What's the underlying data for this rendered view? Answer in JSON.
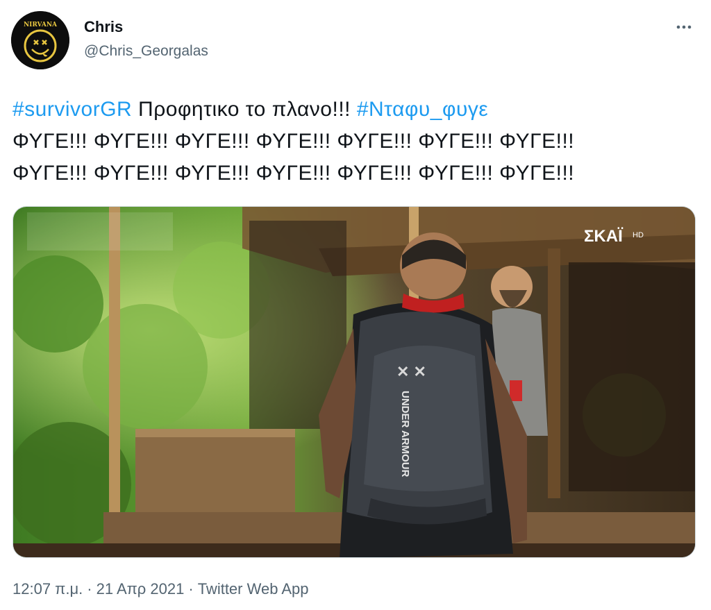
{
  "author": {
    "name": "Chris",
    "handle": "@Chris_Georgalas",
    "avatar_text": "NIRVANA",
    "avatar_icon": "smiley-face-icon"
  },
  "more_icon": "more-horizontal-icon",
  "tweet": {
    "hashtag1": "#survivorGR",
    "text1": " Προφητικο το πλανο!!! ",
    "hashtag2": "#Νταφυ_φυγε",
    "line2": "ΦΥΓΕ!!! ΦΥΓΕ!!! ΦΥΓΕ!!! ΦΥΓΕ!!! ΦΥΓΕ!!! ΦΥΓΕ!!! ΦΥΓΕ!!!",
    "line3": "ΦΥΓΕ!!! ΦΥΓΕ!!! ΦΥΓΕ!!! ΦΥΓΕ!!! ΦΥΓΕ!!! ΦΥΓΕ!!! ΦΥΓΕ!!!"
  },
  "media": {
    "channel_logo": "ΣΚΑΪ",
    "channel_logo_suffix": "HD",
    "backpack_brand": "UNDER ARMOUR"
  },
  "meta": {
    "time": "12:07 π.μ.",
    "date": "21 Απρ 2021",
    "source": "Twitter Web App",
    "separator": "·"
  }
}
